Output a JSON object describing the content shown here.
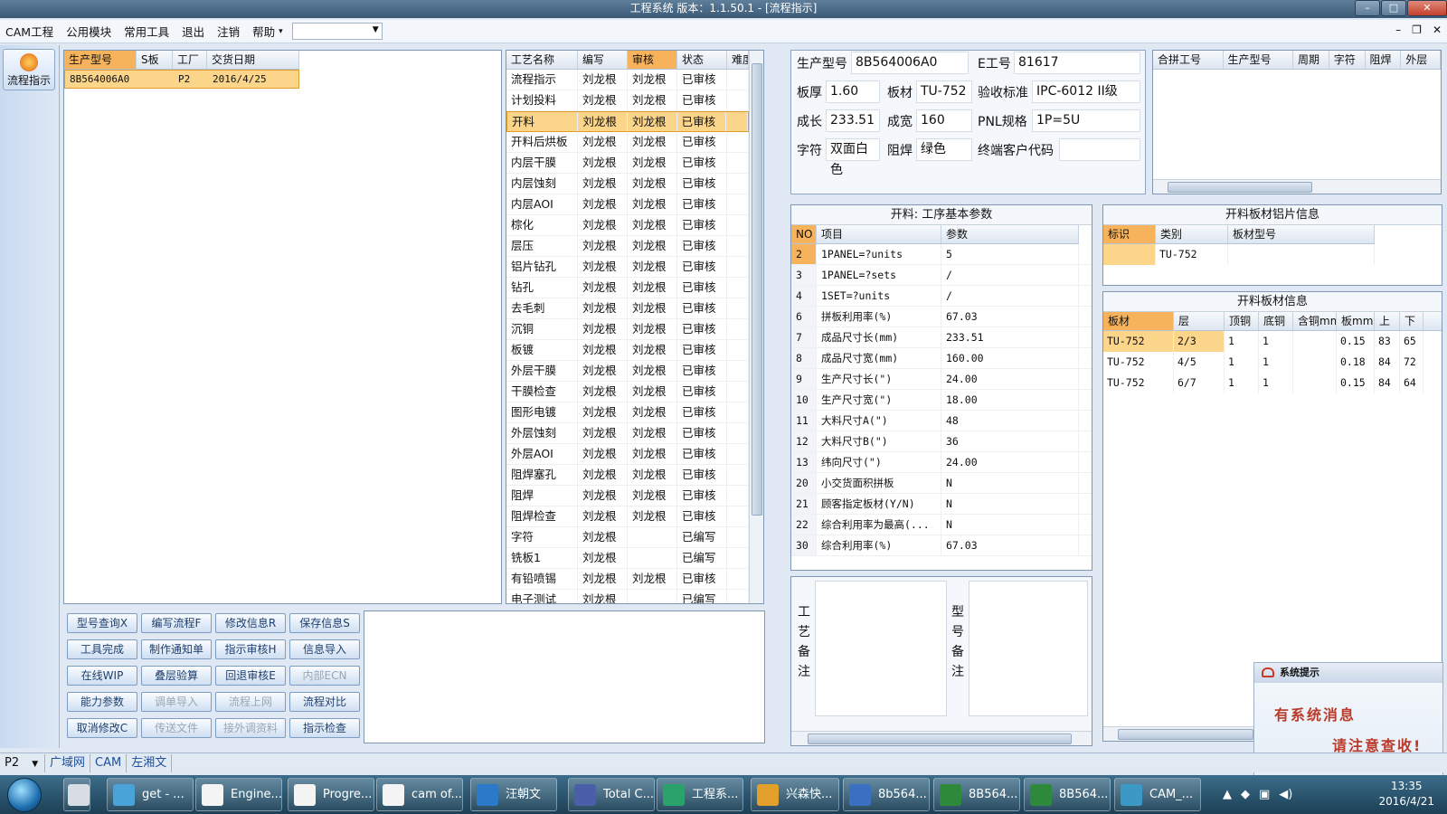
{
  "window": {
    "title": "工程系统  版本：1.1.50.1 - [流程指示]"
  },
  "menu": {
    "items": [
      "CAM工程",
      "公用模块",
      "常用工具",
      "退出",
      "注销",
      "帮助"
    ],
    "help_arrow": "▾",
    "combo_value": ""
  },
  "nav": {
    "flow_label": "流程指示"
  },
  "model_grid": {
    "columns": [
      "生产型号",
      "S板",
      "工厂",
      "交货日期"
    ],
    "rows": [
      {
        "model": "8B564006A0",
        "s": "",
        "factory": "P2",
        "date": "2016/4/25"
      }
    ]
  },
  "process_grid": {
    "columns": [
      "工艺名称",
      "编写",
      "审核",
      "状态",
      "难度"
    ],
    "rows": [
      [
        "流程指示",
        "刘龙根",
        "刘龙根",
        "已审核"
      ],
      [
        "计划投料",
        "刘龙根",
        "刘龙根",
        "已审核"
      ],
      [
        "开料",
        "刘龙根",
        "刘龙根",
        "已审核"
      ],
      [
        "开料后烘板",
        "刘龙根",
        "刘龙根",
        "已审核"
      ],
      [
        "内层干膜",
        "刘龙根",
        "刘龙根",
        "已审核"
      ],
      [
        "内层蚀刻",
        "刘龙根",
        "刘龙根",
        "已审核"
      ],
      [
        "内层AOI",
        "刘龙根",
        "刘龙根",
        "已审核"
      ],
      [
        "棕化",
        "刘龙根",
        "刘龙根",
        "已审核"
      ],
      [
        "层压",
        "刘龙根",
        "刘龙根",
        "已审核"
      ],
      [
        "铝片钻孔",
        "刘龙根",
        "刘龙根",
        "已审核"
      ],
      [
        "钻孔",
        "刘龙根",
        "刘龙根",
        "已审核"
      ],
      [
        "去毛刺",
        "刘龙根",
        "刘龙根",
        "已审核"
      ],
      [
        "沉铜",
        "刘龙根",
        "刘龙根",
        "已审核"
      ],
      [
        "板镀",
        "刘龙根",
        "刘龙根",
        "已审核"
      ],
      [
        "外层干膜",
        "刘龙根",
        "刘龙根",
        "已审核"
      ],
      [
        "干膜检查",
        "刘龙根",
        "刘龙根",
        "已审核"
      ],
      [
        "图形电镀",
        "刘龙根",
        "刘龙根",
        "已审核"
      ],
      [
        "外层蚀刻",
        "刘龙根",
        "刘龙根",
        "已审核"
      ],
      [
        "外层AOI",
        "刘龙根",
        "刘龙根",
        "已审核"
      ],
      [
        "阻焊塞孔",
        "刘龙根",
        "刘龙根",
        "已审核"
      ],
      [
        "阻焊",
        "刘龙根",
        "刘龙根",
        "已审核"
      ],
      [
        "阻焊检查",
        "刘龙根",
        "刘龙根",
        "已审核"
      ],
      [
        "字符",
        "刘龙根",
        "",
        "已编写"
      ],
      [
        "铣板1",
        "刘龙根",
        "",
        "已编写"
      ],
      [
        "有铅喷锡",
        "刘龙根",
        "刘龙根",
        "已审核"
      ],
      [
        "电子测试",
        "刘龙根",
        "",
        "已编写"
      ]
    ]
  },
  "buttons": [
    [
      "型号查询X",
      "编写流程F",
      "修改信息R",
      "保存信息S"
    ],
    [
      "工具完成",
      "制作通知单",
      "指示审核H",
      "信息导入"
    ],
    [
      "在线WIP",
      "叠层验算",
      "回退审核E",
      "内部ECN"
    ],
    [
      "能力参数",
      "调单导入",
      "流程上网",
      "流程对比"
    ],
    [
      "取消修改C",
      "传送文件",
      "接外调资料",
      "指示检查"
    ]
  ],
  "info": {
    "model_label": "生产型号",
    "model": "8B564006A0",
    "ejob_label": "E工号",
    "ejob": "81617",
    "thick_label": "板厚",
    "thick": "1.60",
    "mat_label": "板材",
    "mat": "TU-752",
    "std_label": "验收标准",
    "std": "IPC-6012 II级",
    "len_label": "成长",
    "len": "233.51",
    "wid_label": "成宽",
    "wid": "160",
    "pnl_label": "PNL规格",
    "pnl": "1P=5U",
    "char_label": "字符",
    "char": "双面白色",
    "mask_label": "阻焊",
    "mask": "绿色",
    "cust_label": "终端客户代码",
    "cust": ""
  },
  "merge_grid": {
    "columns": [
      "合拼工号",
      "生产型号",
      "周期",
      "字符",
      "阻焊",
      "外层"
    ]
  },
  "params": {
    "title": "开料: 工序基本参数",
    "columns": [
      "NO",
      "项目",
      "参数"
    ],
    "rows": [
      [
        "2",
        "1PANEL=?units",
        "5"
      ],
      [
        "3",
        "1PANEL=?sets",
        "/"
      ],
      [
        "4",
        "1SET=?units",
        "/"
      ],
      [
        "6",
        "拼板利用率(%)",
        "67.03"
      ],
      [
        "7",
        "成品尺寸长(mm)",
        "233.51"
      ],
      [
        "8",
        "成品尺寸宽(mm)",
        "160.00"
      ],
      [
        "9",
        "生产尺寸长(\")",
        "24.00"
      ],
      [
        "10",
        "生产尺寸宽(\")",
        "18.00"
      ],
      [
        "11",
        "大料尺寸A(\")",
        "48"
      ],
      [
        "12",
        "大料尺寸B(\")",
        "36"
      ],
      [
        "13",
        "纬向尺寸(\")",
        "24.00"
      ],
      [
        "20",
        "小交货面积拼板",
        "N"
      ],
      [
        "21",
        "顾客指定板材(Y/N)",
        "N"
      ],
      [
        "22",
        "综合利用率为最高(...",
        "N"
      ],
      [
        "30",
        "综合利用率(%)",
        "67.03"
      ]
    ]
  },
  "alu": {
    "title": "开料板材铝片信息",
    "columns": [
      "标识",
      "类别",
      "板材型号"
    ],
    "rows": [
      [
        "",
        "TU-752",
        ""
      ]
    ]
  },
  "board": {
    "title": "开料板材信息",
    "columns": [
      "板材",
      "层",
      "顶铜",
      "底铜",
      "含铜mm",
      "板mm",
      "上",
      "下"
    ],
    "rows": [
      [
        "TU-752",
        "2/3",
        "1",
        "1",
        "",
        "0.15",
        "83",
        "65"
      ],
      [
        "TU-752",
        "4/5",
        "1",
        "1",
        "",
        "0.18",
        "84",
        "72"
      ],
      [
        "TU-752",
        "6/7",
        "1",
        "1",
        "",
        "0.15",
        "84",
        "64"
      ]
    ]
  },
  "remarks": {
    "proc_label": [
      "工",
      "艺",
      "备",
      "注"
    ],
    "model_label": [
      "型",
      "号",
      "备",
      "注"
    ]
  },
  "systip": {
    "title": "系统提示",
    "line1": "有系统消息",
    "line2": "请注意查收!"
  },
  "status": {
    "factory": "P2",
    "net": "广域网",
    "dept": "CAM",
    "user": "左湘文"
  },
  "taskbar": {
    "items": [
      {
        "label": "get - ...",
        "color": "#4aa3d8"
      },
      {
        "label": "Engine...",
        "color": "#f4f4f4"
      },
      {
        "label": "Progre...",
        "color": "#f4f4f4"
      },
      {
        "label": "cam of...",
        "color": "#f4f4f4"
      },
      {
        "label": "汪朝文",
        "color": "#2c79c9"
      },
      {
        "label": "Total C...",
        "color": "#4b5fa8"
      },
      {
        "label": "工程系...",
        "color": "#2aa36a"
      },
      {
        "label": "兴森快...",
        "color": "#e2a02a"
      },
      {
        "label": "8b564...",
        "color": "#3a6fc2"
      },
      {
        "label": "8B564...",
        "color": "#2e8a3a"
      },
      {
        "label": "8B564...",
        "color": "#2e8a3a"
      },
      {
        "label": "CAM_...",
        "color": "#3c98c4"
      }
    ],
    "time": "13:35",
    "date": "2016/4/21"
  }
}
